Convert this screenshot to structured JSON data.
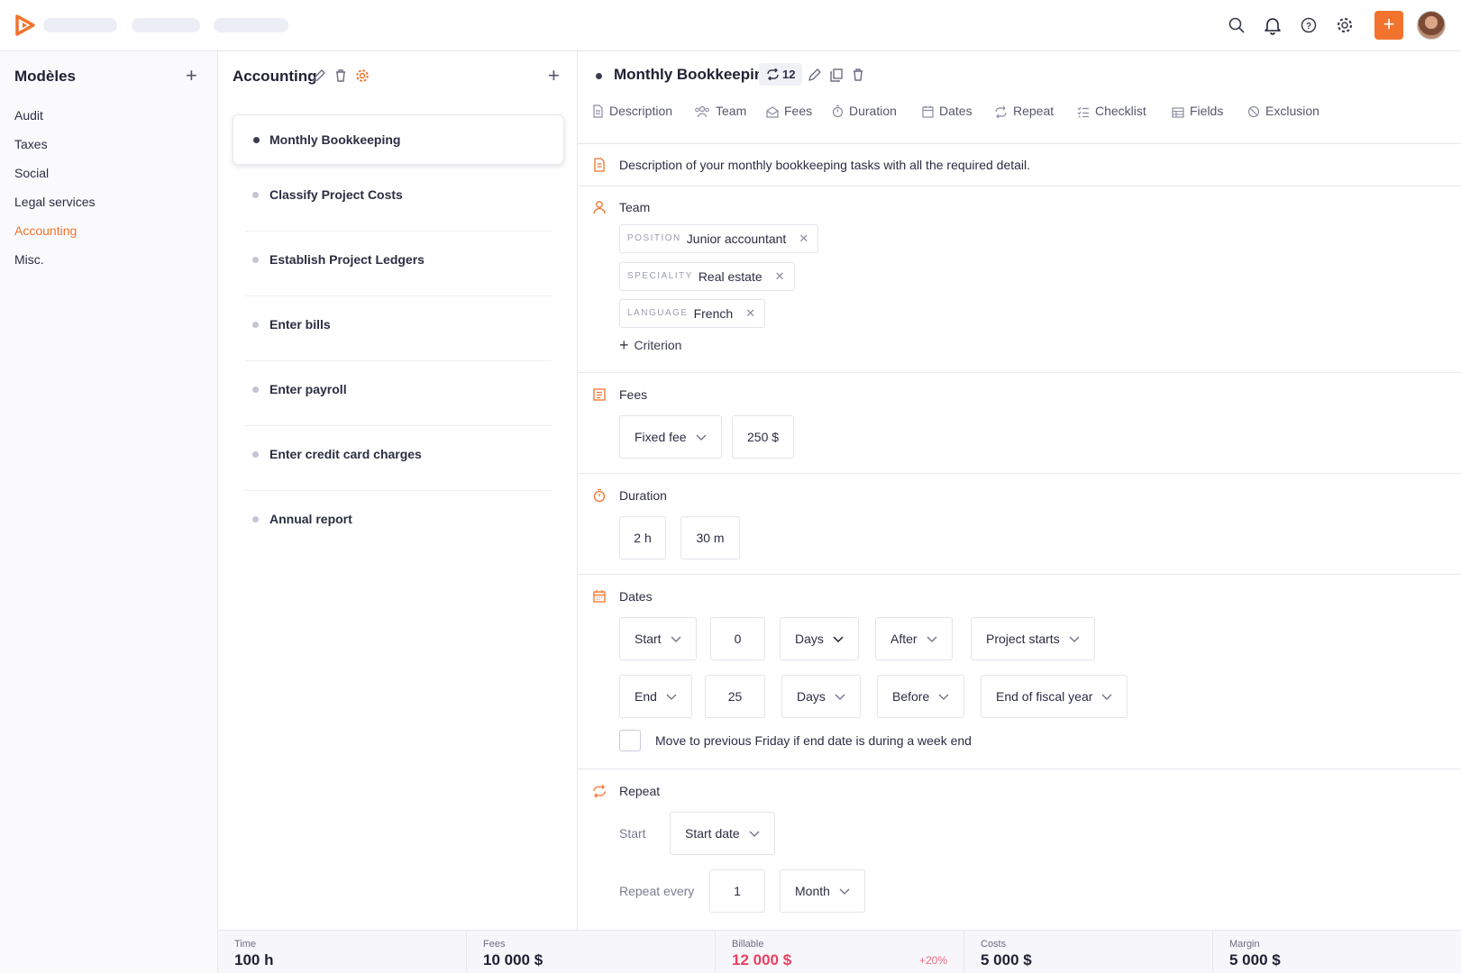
{
  "colors": {
    "accent": "#f2732e",
    "billable": "#ef3f60"
  },
  "topbar": {
    "icons": [
      "search-icon",
      "bell-icon",
      "help-icon",
      "gear-icon"
    ],
    "add_label": "+"
  },
  "sidebar": {
    "title": "Modèles",
    "items": [
      {
        "label": "Audit",
        "active": false
      },
      {
        "label": "Taxes",
        "active": false
      },
      {
        "label": "Social",
        "active": false
      },
      {
        "label": "Legal services",
        "active": false
      },
      {
        "label": "Accounting",
        "active": true
      },
      {
        "label": "Misc.",
        "active": false
      }
    ]
  },
  "list": {
    "title": "Accounting",
    "tasks": [
      {
        "label": "Monthly Bookkeeping",
        "selected": true
      },
      {
        "label": "Classify Project Costs",
        "selected": false
      },
      {
        "label": "Establish Project Ledgers",
        "selected": false
      },
      {
        "label": "Enter bills",
        "selected": false
      },
      {
        "label": "Enter payroll",
        "selected": false
      },
      {
        "label": "Enter credit card charges",
        "selected": false
      },
      {
        "label": "Annual report",
        "selected": false
      }
    ]
  },
  "detail": {
    "title": "Monthly Bookkeeping",
    "repeat_count": "12",
    "tabs": [
      {
        "label": "Description",
        "icon": "document-icon"
      },
      {
        "label": "Team",
        "icon": "team-icon"
      },
      {
        "label": "Fees",
        "icon": "fees-icon"
      },
      {
        "label": "Duration",
        "icon": "stopwatch-icon"
      },
      {
        "label": "Dates",
        "icon": "calendar-icon"
      },
      {
        "label": "Repeat",
        "icon": "repeat-icon"
      },
      {
        "label": "Checklist",
        "icon": "checklist-icon"
      },
      {
        "label": "Fields",
        "icon": "table-icon"
      },
      {
        "label": "Exclusion",
        "icon": "ban-icon"
      }
    ],
    "description": "Description of your monthly bookkeeping tasks with all the required detail.",
    "team": {
      "title": "Team",
      "criteria": [
        {
          "key": "POSITION",
          "value": "Junior accountant"
        },
        {
          "key": "SPECIALITY",
          "value": "Real estate"
        },
        {
          "key": "LANGUAGE",
          "value": "French"
        }
      ],
      "add_label": "Criterion"
    },
    "fees": {
      "title": "Fees",
      "type": "Fixed fee",
      "amount": "250 $"
    },
    "duration": {
      "title": "Duration",
      "hours": "2 h",
      "minutes": "30 m"
    },
    "dates": {
      "title": "Dates",
      "start": {
        "label": "Start",
        "value": "0",
        "unit": "Days",
        "relation": "After",
        "ref": "Project starts"
      },
      "end": {
        "label": "End",
        "value": "25",
        "unit": "Days",
        "relation": "Before",
        "ref": "End of fiscal year"
      },
      "weekend_rule": "Move to previous Friday if end date is during a week end"
    },
    "repeat": {
      "title": "Repeat",
      "start_label": "Start",
      "start_value": "Start date",
      "every_label": "Repeat every",
      "every_value": "1",
      "every_unit": "Month"
    }
  },
  "stats": [
    {
      "label": "Time",
      "value": "100 h"
    },
    {
      "label": "Fees",
      "value": "10 000 $"
    },
    {
      "label": "Billable",
      "value": "12 000 $",
      "delta": "+20%"
    },
    {
      "label": "Costs",
      "value": "5 000 $"
    },
    {
      "label": "Margin",
      "value": "5 000 $"
    }
  ]
}
